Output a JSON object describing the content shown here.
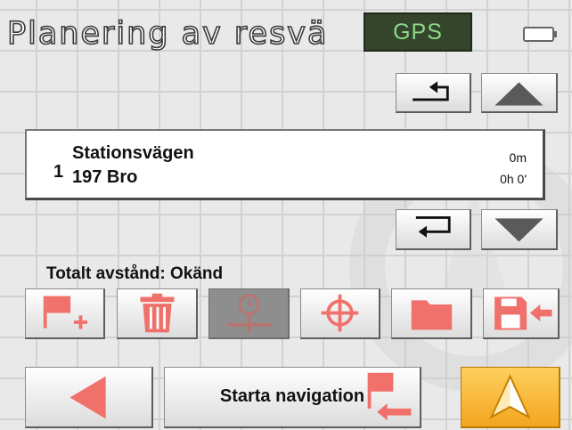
{
  "header": {
    "title": "Planering av resväg",
    "gps_label": "GPS"
  },
  "route": {
    "items": [
      {
        "index": "1",
        "street": "Stationsvägen",
        "city": "197 Bro",
        "distance": "0m",
        "time": "0h 0'"
      }
    ]
  },
  "total_distance": "Totalt avstånd: Okänd",
  "bottom_bar": {
    "start_navigation_label": "Starta navigation"
  },
  "colors": {
    "icon_red": "#f0716b",
    "gps_bg": "#34452c",
    "gps_text": "#8ed98a",
    "ok_orange": "#f6a823"
  }
}
